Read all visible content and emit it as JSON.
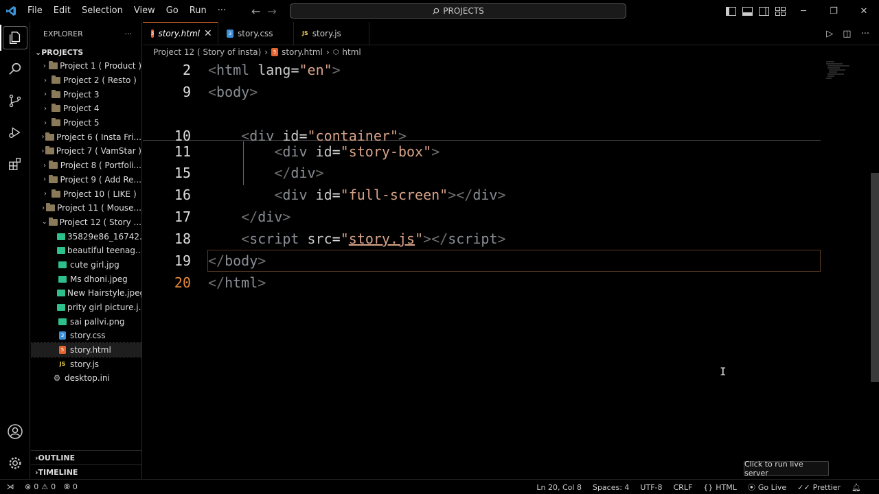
{
  "menu": [
    "File",
    "Edit",
    "Selection",
    "View",
    "Go",
    "Run",
    "···"
  ],
  "command_center": "PROJECTS",
  "sidebar": {
    "title": "EXPLORER",
    "more": "···",
    "root": "PROJECTS",
    "items": [
      {
        "label": "Project 1 ( Product )",
        "type": "folder"
      },
      {
        "label": "Project 2 ( Resto )",
        "type": "folder"
      },
      {
        "label": "Project 3",
        "type": "folder"
      },
      {
        "label": "Project 4",
        "type": "folder"
      },
      {
        "label": "Project 5",
        "type": "folder"
      },
      {
        "label": "Project 6 ( Insta Fri...",
        "type": "folder"
      },
      {
        "label": "Project 7 ( VamStar )",
        "type": "folder"
      },
      {
        "label": "Project 8 ( Portfoli...",
        "type": "folder"
      },
      {
        "label": "Project 9 ( Add  Re...",
        "type": "folder"
      },
      {
        "label": "Project 10 ( LIKE )",
        "type": "folder"
      },
      {
        "label": "Project 11 ( Mouse...",
        "type": "folder"
      },
      {
        "label": "Project 12 ( Story ...",
        "type": "folder-open"
      },
      {
        "label": "35829e86_16742...",
        "type": "image"
      },
      {
        "label": "beautiful teenag...",
        "type": "image"
      },
      {
        "label": "cute girl.jpg",
        "type": "image"
      },
      {
        "label": "Ms dhoni.jpeg",
        "type": "image"
      },
      {
        "label": "New Hairstyle.jpeg",
        "type": "image"
      },
      {
        "label": "prity girl picture.j...",
        "type": "image"
      },
      {
        "label": "sai pallvi.png",
        "type": "image"
      },
      {
        "label": "story.css",
        "type": "css"
      },
      {
        "label": "story.html",
        "type": "html"
      },
      {
        "label": "story.js",
        "type": "js"
      },
      {
        "label": "desktop.ini",
        "type": "ini"
      }
    ],
    "outline": "OUTLINE",
    "timeline": "TIMELINE"
  },
  "tabs": [
    {
      "label": "story.html",
      "type": "html",
      "active": true
    },
    {
      "label": "story.css",
      "type": "css",
      "active": false
    },
    {
      "label": "story.js",
      "type": "js",
      "active": false
    }
  ],
  "breadcrumb": {
    "folder": "Project 12 ( Story of insta)",
    "file": "story.html",
    "symbol": "html"
  },
  "code": {
    "lines": [
      {
        "num": "2",
        "parts": [
          [
            "tag",
            "<"
          ],
          [
            "tagname",
            "html"
          ],
          [
            "attr",
            " lang"
          ],
          [
            "eq",
            "="
          ],
          [
            "str",
            "\"en\""
          ],
          [
            "tag",
            ">"
          ]
        ]
      },
      {
        "num": "9",
        "parts": [
          [
            "tag",
            "<"
          ],
          [
            "tagname",
            "body"
          ],
          [
            "tag",
            ">"
          ]
        ]
      },
      {
        "num": "10",
        "parts": [
          [
            "plain",
            "    "
          ],
          [
            "tag",
            "<"
          ],
          [
            "tagname",
            "div"
          ],
          [
            "attr",
            " id"
          ],
          [
            "eq",
            "="
          ],
          [
            "str",
            "\"container\""
          ],
          [
            "tag",
            ">"
          ]
        ]
      },
      {
        "num": "11",
        "parts": [
          [
            "plain",
            "        "
          ],
          [
            "tag",
            "<"
          ],
          [
            "tagname",
            "div"
          ],
          [
            "attr",
            " id"
          ],
          [
            "eq",
            "="
          ],
          [
            "str",
            "\"story-box\""
          ],
          [
            "tag",
            ">"
          ]
        ]
      },
      {
        "num": "15",
        "parts": [
          [
            "plain",
            "        "
          ],
          [
            "tag",
            "</"
          ],
          [
            "tagname",
            "div"
          ],
          [
            "tag",
            ">"
          ]
        ]
      },
      {
        "num": "16",
        "parts": [
          [
            "plain",
            "        "
          ],
          [
            "tag",
            "<"
          ],
          [
            "tagname",
            "div"
          ],
          [
            "attr",
            " id"
          ],
          [
            "eq",
            "="
          ],
          [
            "str",
            "\"full-screen\""
          ],
          [
            "tag",
            "></"
          ],
          [
            "tagname",
            "div"
          ],
          [
            "tag",
            ">"
          ]
        ]
      },
      {
        "num": "17",
        "parts": [
          [
            "plain",
            "    "
          ],
          [
            "tag",
            "</"
          ],
          [
            "tagname",
            "div"
          ],
          [
            "tag",
            ">"
          ]
        ]
      },
      {
        "num": "18",
        "parts": [
          [
            "plain",
            "    "
          ],
          [
            "tag",
            "<"
          ],
          [
            "tagname",
            "script"
          ],
          [
            "attr",
            " src"
          ],
          [
            "eq",
            "="
          ],
          [
            "str",
            "\""
          ],
          [
            "str-u",
            "story.js"
          ],
          [
            "str",
            "\""
          ],
          [
            "tag",
            "></"
          ],
          [
            "tagname",
            "script"
          ],
          [
            "tag",
            ">"
          ]
        ]
      },
      {
        "num": "19",
        "parts": [
          [
            "tag",
            "</"
          ],
          [
            "tagname",
            "body"
          ],
          [
            "tag",
            ">"
          ]
        ]
      },
      {
        "num": "20",
        "parts": [
          [
            "tag",
            "</"
          ],
          [
            "tagname",
            "html"
          ],
          [
            "tag",
            ">"
          ]
        ],
        "active": true
      }
    ]
  },
  "tooltip": "Click to run live server",
  "status": {
    "errors": "0",
    "warnings": "0",
    "ports": "0",
    "position": "Ln 20, Col 8",
    "spaces": "Spaces: 4",
    "encoding": "UTF-8",
    "eol": "CRLF",
    "language": "HTML",
    "golive": "Go Live",
    "prettier": "Prettier"
  },
  "colors": {
    "accent_orange": "#e08a3c",
    "html_icon": "#e4642f",
    "css_icon": "#3b8fd6",
    "js_icon": "#e8cf4d",
    "image_icon": "#2ec08a"
  }
}
